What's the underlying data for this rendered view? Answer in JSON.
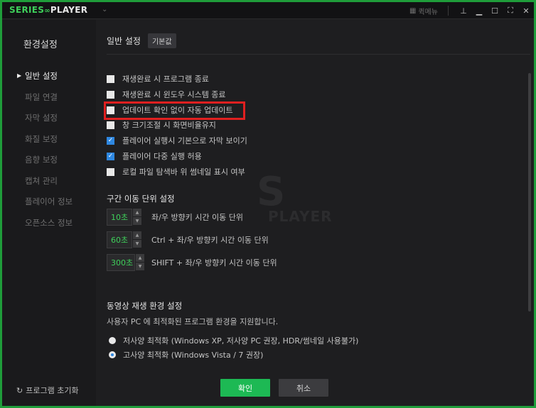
{
  "app": {
    "logo_part1": "SERIES",
    "logo_part2": "PLAYER",
    "quick_menu_label": "퀵메뉴"
  },
  "sidebar": {
    "title": "환경설정",
    "items": [
      {
        "label": "일반 설정",
        "active": true
      },
      {
        "label": "파일 연결"
      },
      {
        "label": "자막 설정"
      },
      {
        "label": "화질 보정"
      },
      {
        "label": "음향 보정"
      },
      {
        "label": "캡쳐 관리"
      },
      {
        "label": "플레이어 정보"
      },
      {
        "label": "오픈소스 정보"
      }
    ],
    "reset_label": "프로그램 초기화"
  },
  "main": {
    "title": "일반 설정",
    "default_button": "기본값",
    "checkboxes": [
      {
        "label": "재생완료 시 프로그램 종료",
        "checked": false
      },
      {
        "label": "재생완료 시 윈도우 시스템 종료",
        "checked": false
      },
      {
        "label": "업데이트 확인 없이 자동 업데이트",
        "checked": false
      },
      {
        "label": "창 크기조절 시 화면비율유지",
        "checked": false
      },
      {
        "label": "플레이어 실행시 기본으로 자막 보이기",
        "checked": true
      },
      {
        "label": "플레이어 다중 실행 허용",
        "checked": true
      },
      {
        "label": "로컬 파일 탐색바 위 썸네일 표시 여부",
        "checked": false
      }
    ],
    "seek_section_title": "구간 이동 단위 설정",
    "seek_steppers": [
      {
        "value": "10초",
        "label": "좌/우 방향키 시간 이동 단위"
      },
      {
        "value": "60초",
        "label": "Ctrl + 좌/우 방향키 시간 이동 단위"
      },
      {
        "value": "300초",
        "label": "SHIFT + 좌/우 방향키 시간 이동 단위"
      }
    ],
    "env_section_title": "동영상 재생 환경 설정",
    "env_description": "사용자 PC 에 최적화된 프로그램 환경을 지원합니다.",
    "radios": [
      {
        "label": "저사양 최적화 (Windows XP, 저사양 PC 권장, HDR/썸네일 사용불가)",
        "selected": false
      },
      {
        "label": "고사양 최적화 (Windows Vista / 7 권장)",
        "selected": true
      }
    ],
    "ok_label": "확인",
    "cancel_label": "취소"
  },
  "watermark": {
    "letter": "S",
    "text": "PLAYER"
  },
  "colors": {
    "accent_green": "#1db954",
    "highlight_red": "#e02020",
    "checkbox_blue": "#2e87e0",
    "frame_green": "#1f9d3a"
  }
}
